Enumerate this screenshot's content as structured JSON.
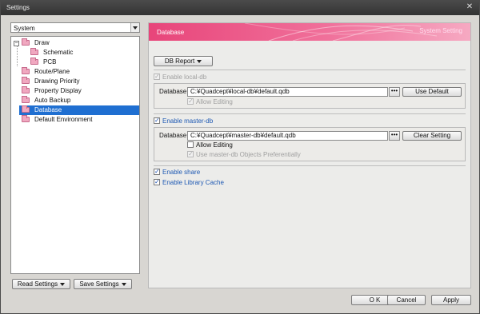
{
  "window": {
    "title": "Settings",
    "close_glyph": "✕"
  },
  "category_select": {
    "value": "System"
  },
  "tree": [
    {
      "label": "Draw",
      "icon": "folder-icon",
      "expander": "−"
    },
    {
      "label": "Schematic",
      "icon": "folder-icon"
    },
    {
      "label": "PCB",
      "icon": "folder-icon"
    },
    {
      "label": "Route/Plane",
      "icon": "folder-icon"
    },
    {
      "label": "Drawing Priority",
      "icon": "folder-icon"
    },
    {
      "label": "Property Display",
      "icon": "folder-icon"
    },
    {
      "label": "Auto Backup",
      "icon": "folder-icon"
    },
    {
      "label": "Database",
      "icon": "folder-icon",
      "selected": true
    },
    {
      "label": "Default Environment",
      "icon": "folder-icon"
    }
  ],
  "left_buttons": {
    "read": "Read Settings",
    "save": "Save Settings"
  },
  "panel": {
    "heading": "Database",
    "subheading": "System Setting",
    "banner_color": "#e8457a",
    "db_report_button": "DB Report",
    "local_db": {
      "enable_label": "Enable local-db",
      "database_label": "Database",
      "path": "C:¥Quadcept¥local-db¥default.qdb",
      "browse": "•••",
      "action_button": "Use Default",
      "allow_editing_label": "Allow Editing"
    },
    "master_db": {
      "enable_label": "Enable master-db",
      "database_label": "Database",
      "path": "C:¥Quadcept¥master-db¥default.qdb",
      "browse": "•••",
      "action_button": "Clear Setting",
      "allow_editing_label": "Allow Editing",
      "prefer_label": "Use master-db Objects Preferentially"
    },
    "enable_share_label": "Enable share",
    "enable_library_cache_label": "Enable Library Cache"
  },
  "footer": {
    "ok": "O K",
    "cancel": "Cancel",
    "apply": "Apply"
  }
}
